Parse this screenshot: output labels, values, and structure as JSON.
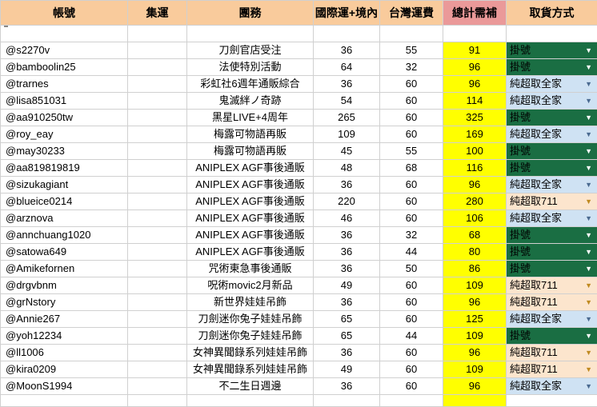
{
  "headers": {
    "account": "帳號",
    "group": "集運",
    "project": "團務",
    "intl_shipping": "國際運+境內",
    "tw_shipping": "台灣運費",
    "total": "總計需補",
    "pickup": "取貨方式"
  },
  "colors": {
    "header_bg": "#f9cb9c",
    "total_header_bg": "#ea9999",
    "total_cell_bg": "#ffff00",
    "pickup_green": "#1a6e43",
    "pickup_blue": "#cfe2f3",
    "pickup_orange": "#fce5cd"
  },
  "icons": {
    "dropdown": "dropdown-arrow-icon"
  },
  "rows": [
    {
      "account": "@s2270v",
      "group": "",
      "project": "刀劍官店受注",
      "intl": "36",
      "tw": "55",
      "total": "91",
      "pickup": "掛號",
      "pickup_style": "green"
    },
    {
      "account": "@bamboolin25",
      "group": "",
      "project": "法使特別活動",
      "intl": "64",
      "tw": "32",
      "total": "96",
      "pickup": "掛號",
      "pickup_style": "green"
    },
    {
      "account": "@trarnes",
      "group": "",
      "project": "彩虹社6週年通販綜合",
      "intl": "36",
      "tw": "60",
      "total": "96",
      "pickup": "純超取全家",
      "pickup_style": "blue"
    },
    {
      "account": "@lisa851031",
      "group": "",
      "project": "鬼滅絆ノ奇跡",
      "intl": "54",
      "tw": "60",
      "total": "114",
      "pickup": "純超取全家",
      "pickup_style": "blue"
    },
    {
      "account": "@aa910250tw",
      "group": "",
      "project": "黑星LIVE+4周年",
      "intl": "265",
      "tw": "60",
      "total": "325",
      "pickup": "掛號",
      "pickup_style": "green"
    },
    {
      "account": "@roy_eay",
      "group": "",
      "project": "梅露可物語再販",
      "intl": "109",
      "tw": "60",
      "total": "169",
      "pickup": "純超取全家",
      "pickup_style": "blue"
    },
    {
      "account": "@may30233",
      "group": "",
      "project": "梅露可物語再販",
      "intl": "45",
      "tw": "55",
      "total": "100",
      "pickup": "掛號",
      "pickup_style": "green"
    },
    {
      "account": "@aa819819819",
      "group": "",
      "project": "ANIPLEX AGF事後通販",
      "intl": "48",
      "tw": "68",
      "total": "116",
      "pickup": "掛號",
      "pickup_style": "green"
    },
    {
      "account": "@sizukagiant",
      "group": "",
      "project": "ANIPLEX AGF事後通販",
      "intl": "36",
      "tw": "60",
      "total": "96",
      "pickup": "純超取全家",
      "pickup_style": "blue"
    },
    {
      "account": "@blueice0214",
      "group": "",
      "project": "ANIPLEX AGF事後通販",
      "intl": "220",
      "tw": "60",
      "total": "280",
      "pickup": "純超取711",
      "pickup_style": "orange"
    },
    {
      "account": "@arznova",
      "group": "",
      "project": "ANIPLEX AGF事後通販",
      "intl": "46",
      "tw": "60",
      "total": "106",
      "pickup": "純超取全家",
      "pickup_style": "blue"
    },
    {
      "account": "@annchuang1020",
      "group": "",
      "project": "ANIPLEX AGF事後通販",
      "intl": "36",
      "tw": "32",
      "total": "68",
      "pickup": "掛號",
      "pickup_style": "green"
    },
    {
      "account": "@satowa649",
      "group": "",
      "project": "ANIPLEX AGF事後通販",
      "intl": "36",
      "tw": "44",
      "total": "80",
      "pickup": "掛號",
      "pickup_style": "green"
    },
    {
      "account": "@Amikefornen",
      "group": "",
      "project": "咒術東急事後通販",
      "intl": "36",
      "tw": "50",
      "total": "86",
      "pickup": "掛號",
      "pickup_style": "green"
    },
    {
      "account": "@drgvbnm",
      "group": "",
      "project": "呪術movic2月新品",
      "intl": "49",
      "tw": "60",
      "total": "109",
      "pickup": "純超取711",
      "pickup_style": "orange"
    },
    {
      "account": "@grNstory",
      "group": "",
      "project": "新世界娃娃吊飾",
      "intl": "36",
      "tw": "60",
      "total": "96",
      "pickup": "純超取711",
      "pickup_style": "orange"
    },
    {
      "account": "@Annie267",
      "group": "",
      "project": "刀劍迷你兔子娃娃吊飾",
      "intl": "65",
      "tw": "60",
      "total": "125",
      "pickup": "純超取全家",
      "pickup_style": "blue"
    },
    {
      "account": "@yoh12234",
      "group": "",
      "project": "刀劍迷你兔子娃娃吊飾",
      "intl": "65",
      "tw": "44",
      "total": "109",
      "pickup": "掛號",
      "pickup_style": "green"
    },
    {
      "account": "@ll1006",
      "group": "",
      "project": "女神異聞錄系列娃娃吊飾",
      "intl": "36",
      "tw": "60",
      "total": "96",
      "pickup": "純超取711",
      "pickup_style": "orange"
    },
    {
      "account": "@kira0209",
      "group": "",
      "project": "女神異聞錄系列娃娃吊飾",
      "intl": "49",
      "tw": "60",
      "total": "109",
      "pickup": "純超取711",
      "pickup_style": "orange"
    },
    {
      "account": "@MoonS1994",
      "group": "",
      "project": "不二生日週邊",
      "intl": "36",
      "tw": "60",
      "total": "96",
      "pickup": "純超取全家",
      "pickup_style": "blue"
    }
  ]
}
